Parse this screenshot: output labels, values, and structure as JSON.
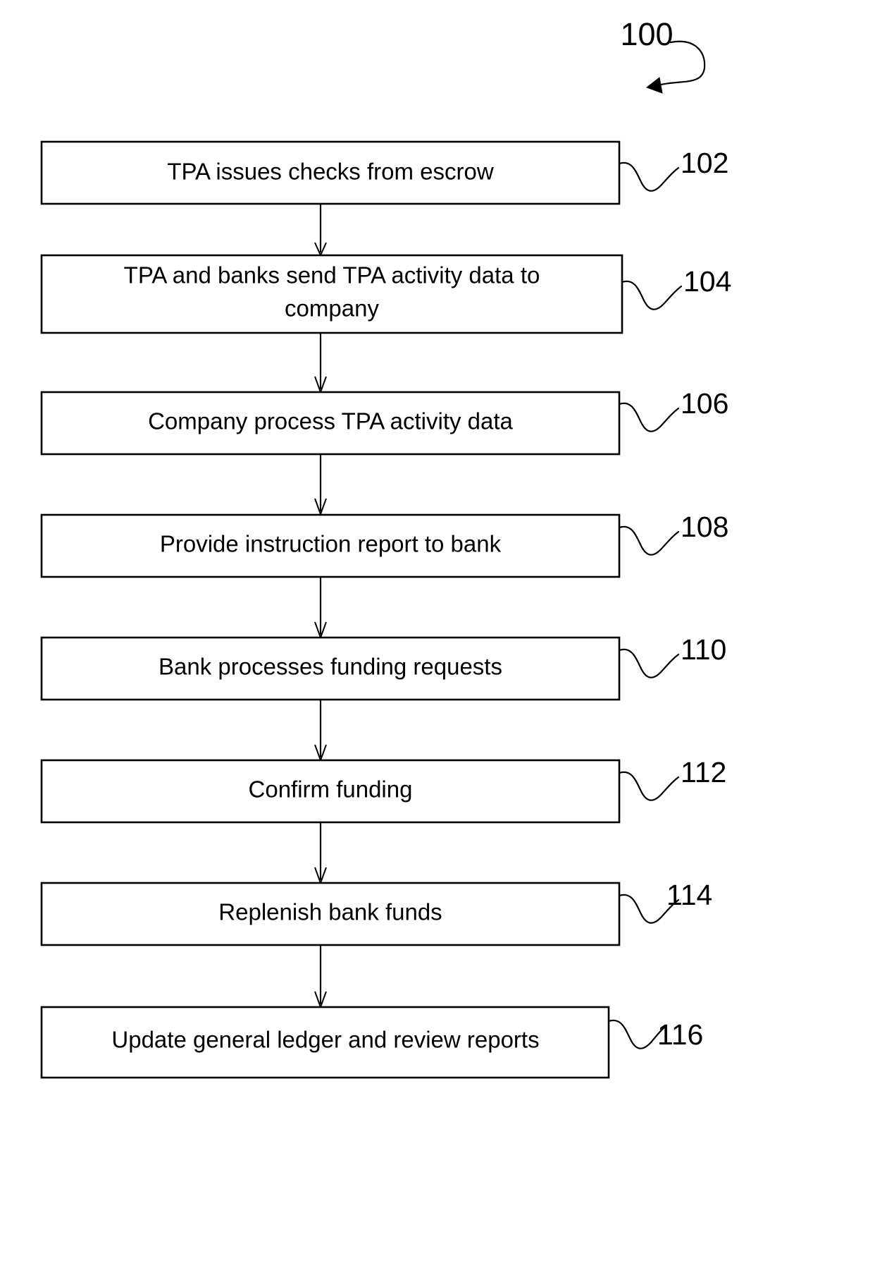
{
  "figure": {
    "number": "100",
    "pointer_icon": "curved-arrow-icon"
  },
  "diagram": {
    "type": "flowchart",
    "orientation": "vertical",
    "colors": {
      "stroke": "#000000",
      "fill": "#ffffff",
      "text": "#000000"
    },
    "steps": [
      {
        "ref": "102",
        "lines": [
          "TPA issues checks from escrow"
        ],
        "text": "TPA issues checks from escrow"
      },
      {
        "ref": "104",
        "lines": [
          "TPA and banks send TPA activity data to",
          "company"
        ],
        "text": "TPA and banks send TPA activity data to company"
      },
      {
        "ref": "106",
        "lines": [
          "Company process TPA activity data"
        ],
        "text": "Company process TPA activity data"
      },
      {
        "ref": "108",
        "lines": [
          "Provide instruction report to bank"
        ],
        "text": "Provide instruction report to bank"
      },
      {
        "ref": "110",
        "lines": [
          "Bank processes funding requests"
        ],
        "text": "Bank processes funding requests"
      },
      {
        "ref": "112",
        "lines": [
          "Confirm funding"
        ],
        "text": "Confirm funding"
      },
      {
        "ref": "114",
        "lines": [
          "Replenish bank funds"
        ],
        "text": "Replenish bank funds"
      },
      {
        "ref": "116",
        "lines": [
          "Update general ledger and review reports"
        ],
        "text": "Update general ledger and review reports"
      }
    ],
    "connectors": [
      {
        "from": "102",
        "to": "104",
        "icon": "down-arrow-icon"
      },
      {
        "from": "104",
        "to": "106",
        "icon": "down-arrow-icon"
      },
      {
        "from": "106",
        "to": "108",
        "icon": "down-arrow-icon"
      },
      {
        "from": "108",
        "to": "110",
        "icon": "down-arrow-icon"
      },
      {
        "from": "110",
        "to": "112",
        "icon": "down-arrow-icon"
      },
      {
        "from": "112",
        "to": "114",
        "icon": "down-arrow-icon"
      },
      {
        "from": "114",
        "to": "116",
        "icon": "down-arrow-icon"
      }
    ]
  }
}
